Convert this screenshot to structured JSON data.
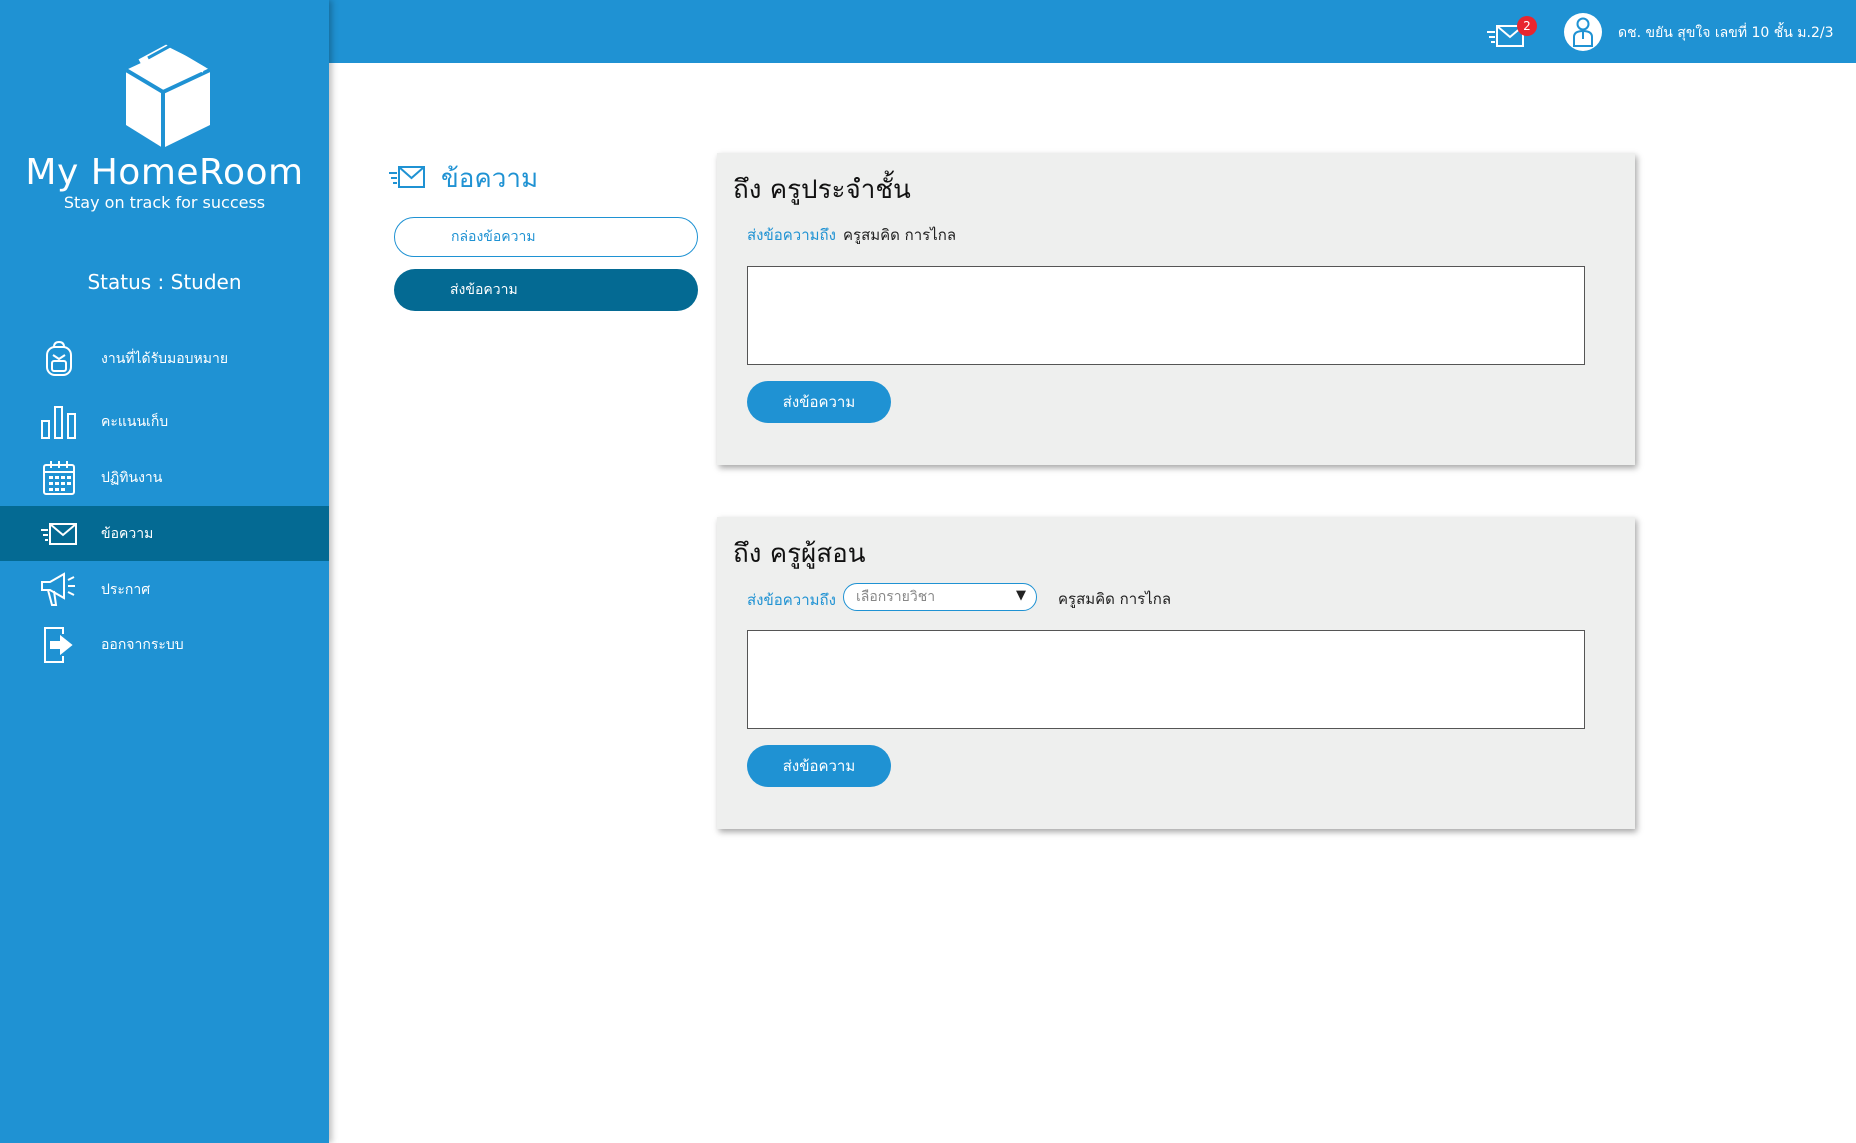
{
  "brand": {
    "name": "My HomeRoom",
    "tagline": "Stay on track for success"
  },
  "status_text": "Status : Studen",
  "sidebar": {
    "items": [
      {
        "label": "งานที่ได้รับมอบหมาย",
        "icon": "backpack-icon"
      },
      {
        "label": "คะแนนเก็บ",
        "icon": "bar-chart-icon"
      },
      {
        "label": "ปฏิทินงาน",
        "icon": "calendar-icon"
      },
      {
        "label": "ข้อความ",
        "icon": "mail-icon",
        "active": true
      },
      {
        "label": "ประกาศ",
        "icon": "megaphone-icon"
      },
      {
        "label": "ออกจากระบบ",
        "icon": "logout-icon"
      }
    ]
  },
  "header": {
    "notification_count": "2",
    "user_name": "ดช. ขยัน สุขใจ เลขที่ 10 ชั้น ม.2/3"
  },
  "messages": {
    "title": "ข้อความ",
    "inbox_label": "กล่องข้อความ",
    "send_label": "ส่งข้อความ"
  },
  "card_homeroom": {
    "title": "ถึง ครูประจำชั้น",
    "to_label": "ส่งข้อความถึง",
    "recipient": "ครูสมคิด การไกล",
    "button": "ส่งข้อความ"
  },
  "card_subject": {
    "title": "ถึง ครูผู้สอน",
    "to_label": "ส่งข้อความถึง",
    "select_placeholder": "เลือกรายวิชา",
    "recipient": "ครูสมคิด การไกล",
    "button": "ส่งข้อความ"
  },
  "colors": {
    "primary": "#1f92d3",
    "active": "#046a93",
    "card_bg": "#eeefee",
    "badge": "#e8262f"
  }
}
